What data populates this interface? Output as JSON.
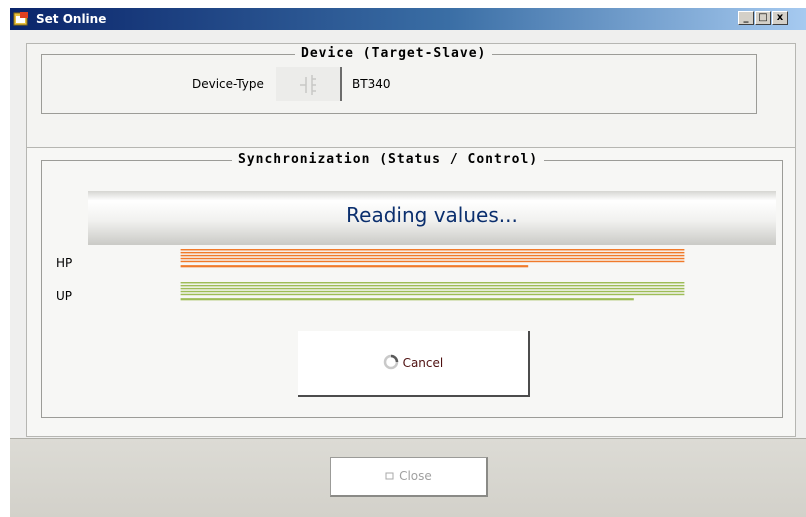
{
  "window": {
    "title": "Set Online",
    "minimize_label": "_",
    "maximize_label": "□",
    "close_label": "x"
  },
  "device_group": {
    "title": "Device (Target-Slave)",
    "device_type_label": "Device-Type",
    "device_type_value": "BT340"
  },
  "sync_group": {
    "title": "Synchronization (Status / Control)",
    "status_text": "Reading values...",
    "bars": [
      {
        "label": "HP",
        "color": "#f07a2a",
        "progress": 0.69
      },
      {
        "label": "UP",
        "color": "#9ebd57",
        "progress": 0.9
      }
    ],
    "cancel_label": "Cancel"
  },
  "footer": {
    "close_label": "Close"
  },
  "colors": {
    "titlebar": "#0a246a",
    "status_text": "#0b2f6e",
    "hp_bar": "#f07a2a",
    "up_bar": "#9ebd57"
  },
  "icons": {
    "app": "app-window-icon",
    "device_button": "device-connector-icon",
    "cancel": "spinner-icon",
    "close": "close-square-icon"
  }
}
